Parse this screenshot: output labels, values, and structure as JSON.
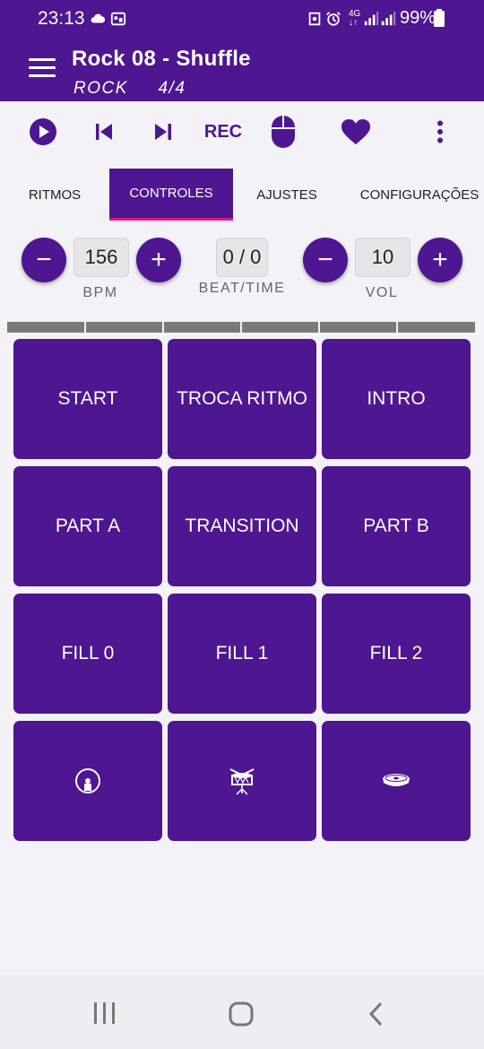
{
  "status_bar": {
    "time": "23:13",
    "battery": "99%",
    "icons": [
      "cloud-icon",
      "photo-icon",
      "lock-icon",
      "alarm-icon",
      "4g-icon",
      "signal-icon",
      "signal-icon",
      "battery-icon"
    ]
  },
  "app_bar": {
    "title": "Rock 08 - Shuffle",
    "subtitle_style": "ROCK",
    "subtitle_meter": "4/4"
  },
  "toolbar": {
    "play_icon": "play-icon",
    "previous_icon": "skip-previous-icon",
    "next_icon": "skip-next-icon",
    "rec_label": "REC",
    "mouse_icon": "mouse-icon",
    "favorite_icon": "heart-icon",
    "more_icon": "more-vertical-icon"
  },
  "tabs": [
    {
      "label": "RITMOS",
      "selected": false
    },
    {
      "label": "CONTROLES",
      "selected": true
    },
    {
      "label": "AJUSTES",
      "selected": false
    },
    {
      "label": "CONFIGURAÇÕES",
      "selected": false
    }
  ],
  "controls": {
    "bpm": {
      "value": "156",
      "label": "BPM",
      "minus": "−",
      "plus": "+"
    },
    "beat_time": {
      "value": "0 / 0",
      "label": "BEAT/TIME"
    },
    "vol": {
      "value": "10",
      "label": "VOL",
      "minus": "−",
      "plus": "+"
    }
  },
  "beat_segments": 6,
  "pads": [
    {
      "label": "START"
    },
    {
      "label": "TROCA RITMO"
    },
    {
      "label": "INTRO"
    },
    {
      "label": "PART A"
    },
    {
      "label": "TRANSITION"
    },
    {
      "label": "PART B"
    },
    {
      "label": "FILL 0"
    },
    {
      "label": "FILL 1"
    },
    {
      "label": "FILL 2"
    },
    {
      "icon": "bass-drum-icon"
    },
    {
      "icon": "snare-drum-icon"
    },
    {
      "icon": "cymbal-icon"
    }
  ],
  "nav_bar": {
    "recents_icon": "recents-icon",
    "home_icon": "home-icon",
    "back_icon": "back-icon"
  },
  "colors": {
    "primary": "#4e1690",
    "tab_indicator": "#d81b7a",
    "segment": "#7a7a7a",
    "background": "#f3f2f7"
  }
}
